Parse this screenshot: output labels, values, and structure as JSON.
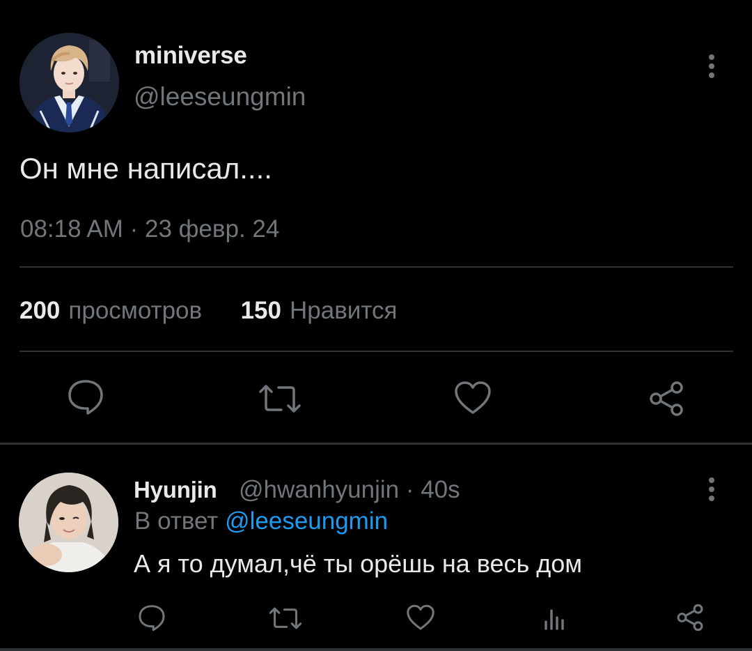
{
  "main_tweet": {
    "display_name": "miniverse",
    "handle": "@leeseungmin",
    "text": "Он мне написал....",
    "meta": "08:18 AM · 23 февр. 24",
    "stats": {
      "views_count": "200",
      "views_label": "просмотров",
      "likes_count": "150",
      "likes_label": "Нравится"
    },
    "actions": [
      "reply-icon",
      "retweet-icon",
      "like-icon",
      "share-icon"
    ]
  },
  "reply": {
    "display_name": "Hyunjin",
    "handle_line": "@hwanhyunjin · 40s",
    "replying_to_prefix": "В ответ",
    "replying_to_mention": "@leeseungmin",
    "text": "А я то думал,чё ты орёшь на весь дом",
    "actions": [
      "reply-icon",
      "retweet-icon",
      "like-icon",
      "views-icon",
      "share-icon"
    ]
  },
  "colors": {
    "background": "#000000",
    "primary_text": "#e7e9ea",
    "secondary_text": "#71767b",
    "divider": "#2f3336",
    "accent": "#1d9bf0"
  }
}
